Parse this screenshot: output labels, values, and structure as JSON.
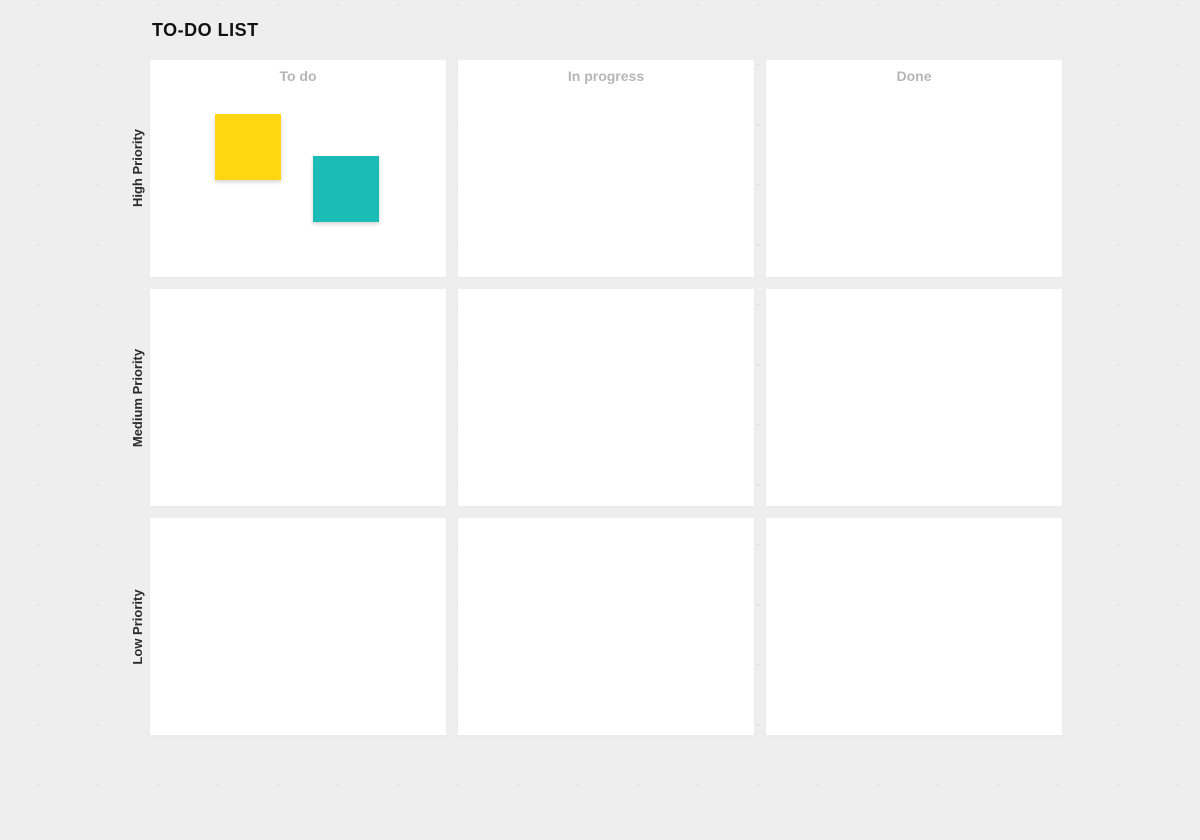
{
  "title": "TO-DO LIST",
  "columns": {
    "todo": "To do",
    "in_progress": "In progress",
    "done": "Done"
  },
  "rows": {
    "high": "High Priority",
    "medium": "Medium Priority",
    "low": "Low Priority"
  },
  "stickies": {
    "yellow_color": "#ffd612",
    "teal_color": "#1bbcb6"
  }
}
